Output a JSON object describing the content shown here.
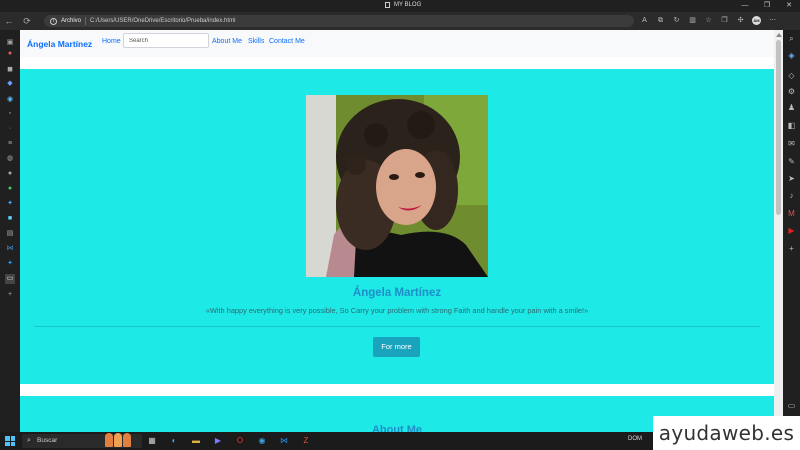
{
  "window": {
    "title": "MY BLOG",
    "controls": [
      "—",
      "❐",
      "✕"
    ]
  },
  "addressbar": {
    "back_icon": "←",
    "reload_icon": "⟳",
    "info_icon": "i",
    "scheme_label": "Archivo",
    "path": "C:/Users/USER/OneDrive/Escritorio/Prueba/index.html",
    "profile_initials": "ÁM"
  },
  "site": {
    "brand": "Ángela Martínez",
    "nav": {
      "home": "Home",
      "search_placeholder": "Search",
      "about": "About Me",
      "skills": "Skills",
      "contact": "Contact Me"
    },
    "hero": {
      "name": "Ángela Martínez",
      "quote": "«With happy everything is very possible, So Carry your problem with strong Faith and handle your pain with a smile!»",
      "button": "For more"
    },
    "about": {
      "title": "About Me"
    }
  },
  "taskbar": {
    "search_label": "Buscar",
    "tray_text": "DOM"
  },
  "watermark": "ayudaweb.es",
  "colors": {
    "hero_bg": "#1de9e7",
    "brand_blue": "#0d6efd",
    "name_blue": "#1f8ec7",
    "button_bg": "#1aa3bd"
  }
}
